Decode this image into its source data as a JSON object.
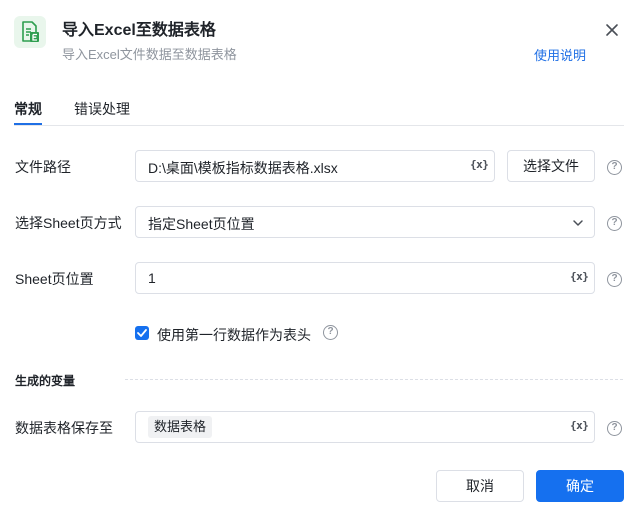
{
  "header": {
    "title": "导入Excel至数据表格",
    "subtitle": "导入Excel文件数据至数据表格",
    "help_link": "使用说明"
  },
  "tabs": [
    {
      "label": "常规",
      "active": true
    },
    {
      "label": "错误处理",
      "active": false
    }
  ],
  "form": {
    "file_path": {
      "label": "文件路径",
      "value": "D:\\桌面\\模板指标数据表格.xlsx",
      "button_label": "选择文件"
    },
    "sheet_mode": {
      "label": "选择Sheet页方式",
      "value": "指定Sheet页位置"
    },
    "sheet_position": {
      "label": "Sheet页位置",
      "value": "1"
    },
    "header_checkbox": {
      "label": "使用第一行数据作为表头",
      "checked": true
    }
  },
  "output": {
    "section_title": "生成的变量",
    "save_to": {
      "label": "数据表格保存至",
      "tag": "数据表格"
    }
  },
  "variable_icon_text": "{x}",
  "help_icon_text": "?",
  "footer": {
    "cancel_label": "取消",
    "confirm_label": "确定"
  },
  "colors": {
    "accent": "#1570ef",
    "link": "#1f6fe5",
    "app_icon": "#2e9e4f"
  }
}
